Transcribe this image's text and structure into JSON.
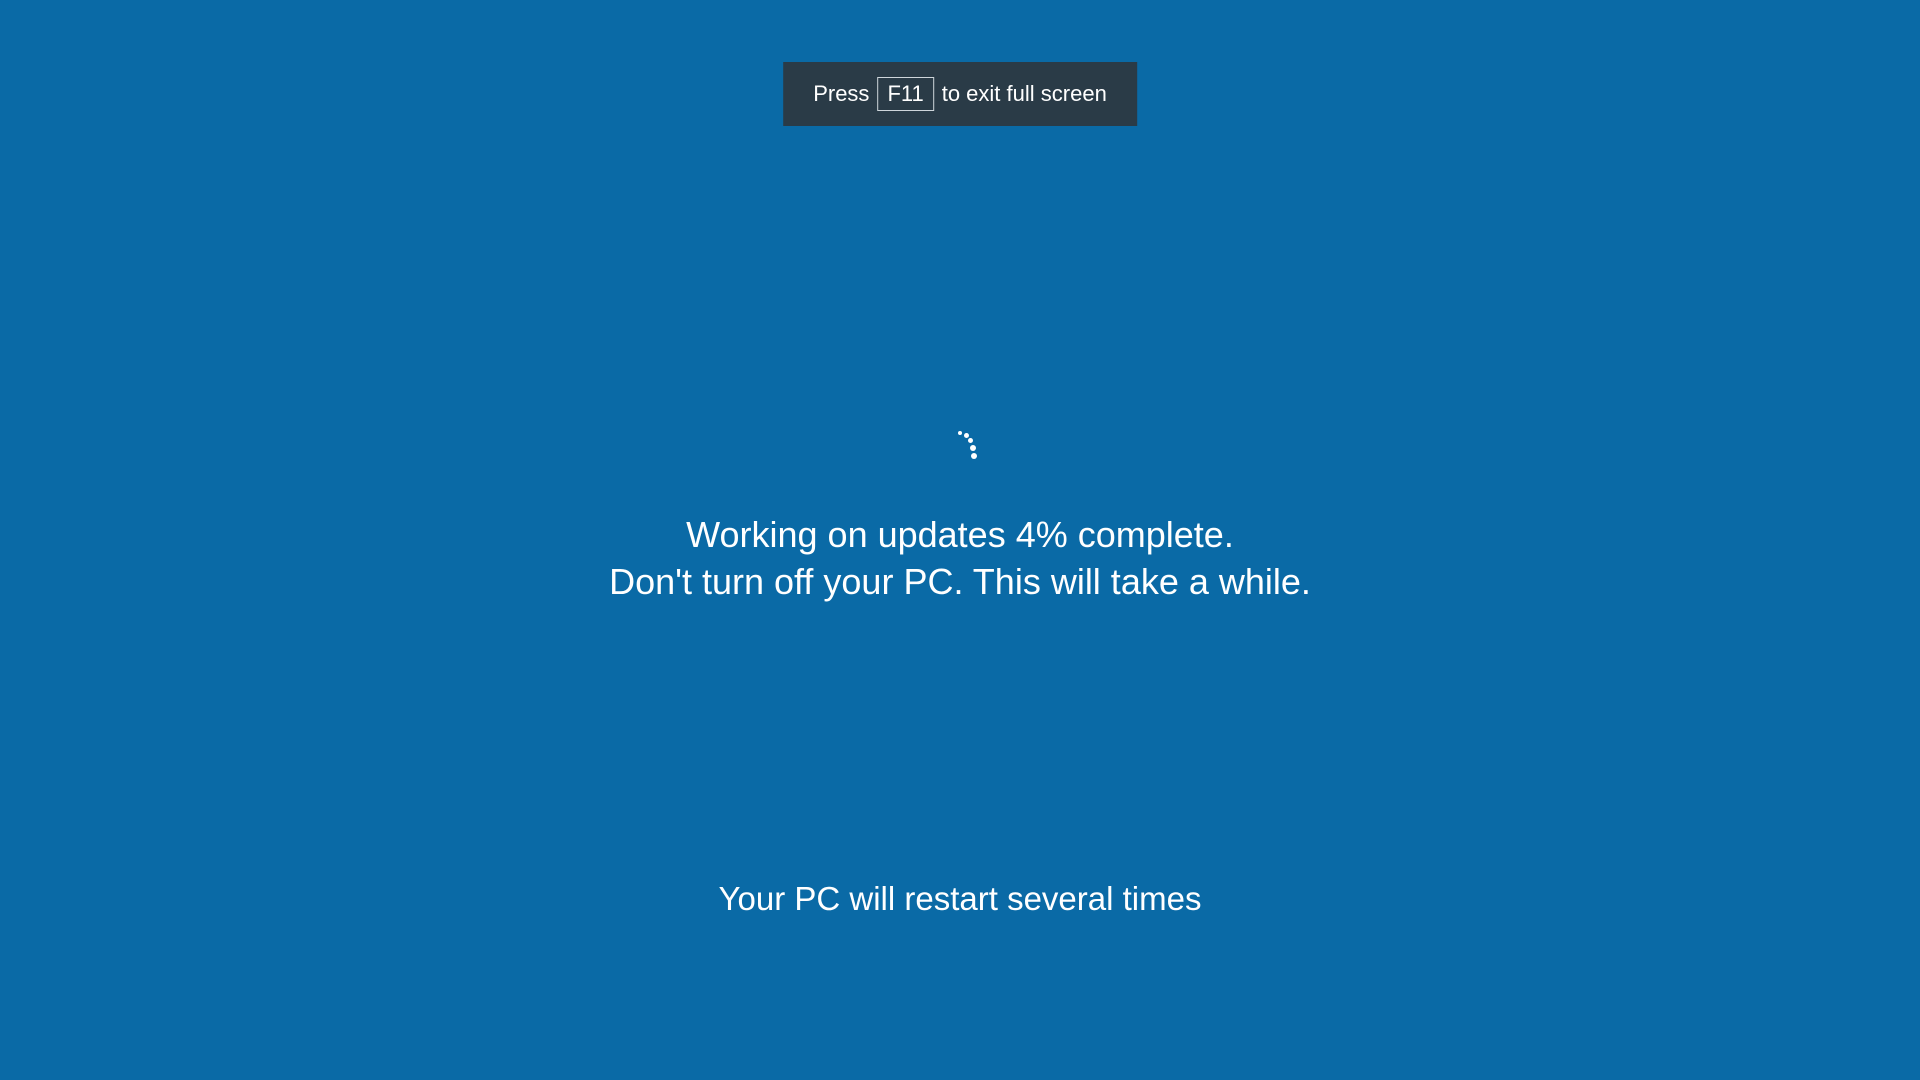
{
  "hint": {
    "prefix": "Press",
    "key": "F11",
    "suffix": "to exit full screen"
  },
  "update": {
    "line1": "Working on updates  4% complete.",
    "line2": "Don't turn off your PC. This will take a while.",
    "percent": 4
  },
  "footer": "Your PC will restart several times",
  "colors": {
    "background": "#0a6aa6",
    "hintBackground": "#2a3b47",
    "text": "#ffffff"
  }
}
